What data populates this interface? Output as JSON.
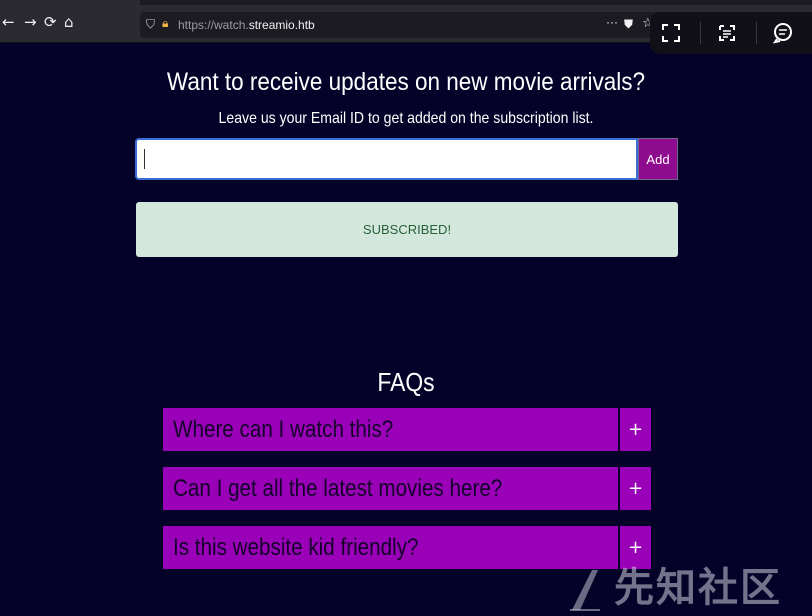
{
  "browser": {
    "url_prefix": "https://watch.",
    "url_host": "streamio.htb",
    "nav": {
      "back": "←",
      "forward": "→",
      "reload": "⟳",
      "home": "⌂"
    },
    "more": "···",
    "overlay_icons": [
      "fullscreen-icon",
      "ocr-icon",
      "chat-icon"
    ]
  },
  "newsletter": {
    "heading": "Want to receive updates on new movie arrivals?",
    "subheading": "Leave us your Email ID to get added on the subscription list.",
    "email_value": "",
    "add_label": "Add",
    "status": "SUBSCRIBED!"
  },
  "faq": {
    "title": "FAQs",
    "items": [
      {
        "question": "Where can I watch this?",
        "toggle": "+"
      },
      {
        "question": "Can I get all the latest movies here?",
        "toggle": "+"
      },
      {
        "question": "Is this website kid friendly?",
        "toggle": "+"
      }
    ]
  },
  "watermark": {
    "text": "先知社区"
  },
  "colors": {
    "page_bg": "#05022a",
    "accent_purple": "#9a00b8",
    "button_purple": "#8e0a8e",
    "success_bg": "#d4e7dd",
    "success_text": "#26613a"
  }
}
